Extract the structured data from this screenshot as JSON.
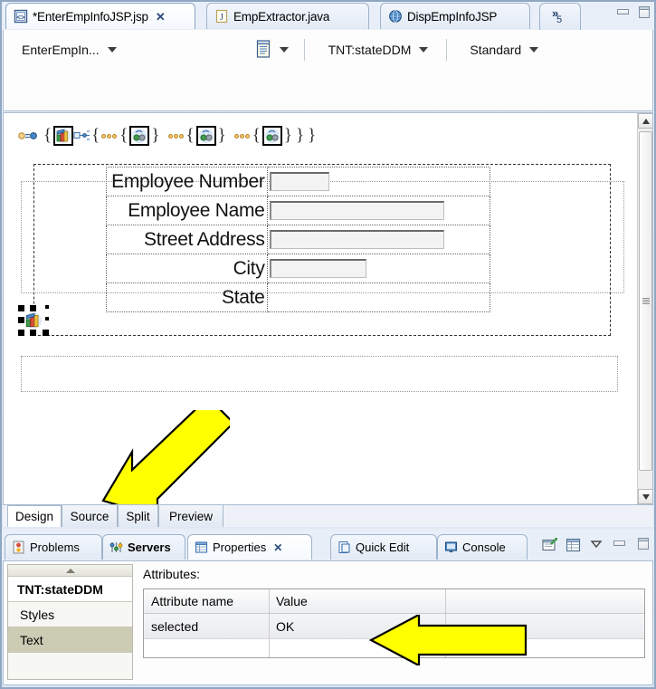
{
  "editor": {
    "tabs": [
      {
        "label": "*EnterEmpInfoJSP.jsp",
        "icon": "jsp-file-icon",
        "active": true,
        "close": "✕"
      },
      {
        "label": "EmpExtractor.java",
        "icon": "java-file-icon",
        "active": false,
        "close": ""
      },
      {
        "label": "DispEmpInfoJSP",
        "icon": "globe-file-icon",
        "active": false,
        "close": ""
      }
    ],
    "overflow": {
      "chevron": "»",
      "count": "5"
    },
    "window_controls": {
      "minimize": "minimize-icon",
      "maximize": "maximize-icon"
    }
  },
  "toolbar": {
    "file_combo": "EnterEmpIn...",
    "page_icon": "page-template-icon",
    "element_combo": "TNT:stateDDM",
    "style_combo": "Standard",
    "caret": "▼"
  },
  "design": {
    "icon_strip": {
      "braces": "{ { { } { } { } } }",
      "nodes": [
        "link-node-icon",
        "books-tag-icon",
        "connector-icon",
        "select-tag-icon",
        "select-tag-icon",
        "select-tag-icon"
      ]
    },
    "form_rows": [
      {
        "label": "Employee Number",
        "input_width": 66
      },
      {
        "label": "Employee Name",
        "input_width": 193
      },
      {
        "label": "Street Address",
        "input_width": 193
      },
      {
        "label": "City",
        "input_width": 107
      },
      {
        "label": "State",
        "input_width": 0
      }
    ],
    "selected_widget": "books-tag-icon",
    "annotation_arrow_diagonal": "yellow-arrow-pointing-down-left"
  },
  "mode_tabs": [
    {
      "label": "Design",
      "active": true
    },
    {
      "label": "Source",
      "active": false
    },
    {
      "label": "Split",
      "active": false
    },
    {
      "label": "Preview",
      "active": false
    }
  ],
  "bottom_panel": {
    "tabs": [
      {
        "label": "Problems",
        "icon": "problems-icon",
        "active": false,
        "bold": false,
        "close": ""
      },
      {
        "label": "Servers",
        "icon": "servers-icon",
        "active": false,
        "bold": true,
        "close": ""
      },
      {
        "label": "Properties",
        "icon": "properties-icon",
        "active": true,
        "bold": false,
        "close": "✕"
      },
      {
        "label": "Quick Edit",
        "icon": "quick-edit-icon",
        "active": false,
        "bold": false,
        "close": ""
      },
      {
        "label": "Console",
        "icon": "console-icon",
        "active": false,
        "bold": false,
        "close": ""
      }
    ],
    "view_buttons": [
      "new-properties-view-icon",
      "show-table-icon",
      "view-menu-icon",
      "minimize-icon",
      "maximize-icon"
    ],
    "category_list": [
      {
        "label": "TNT:stateDDM",
        "state": "header"
      },
      {
        "label": "Styles",
        "state": "normal"
      },
      {
        "label": "Text",
        "state": "selected"
      }
    ],
    "attributes_label": "Attributes:",
    "attr_columns": [
      "Attribute name",
      "Value"
    ],
    "attr_rows": [
      {
        "name": "selected",
        "value": "OK"
      }
    ],
    "annotation_arrow_left": "yellow-arrow-pointing-left"
  },
  "colors": {
    "accent": "#ffff00",
    "tab_border": "#9db3cc",
    "selection": "#ccccb5"
  }
}
